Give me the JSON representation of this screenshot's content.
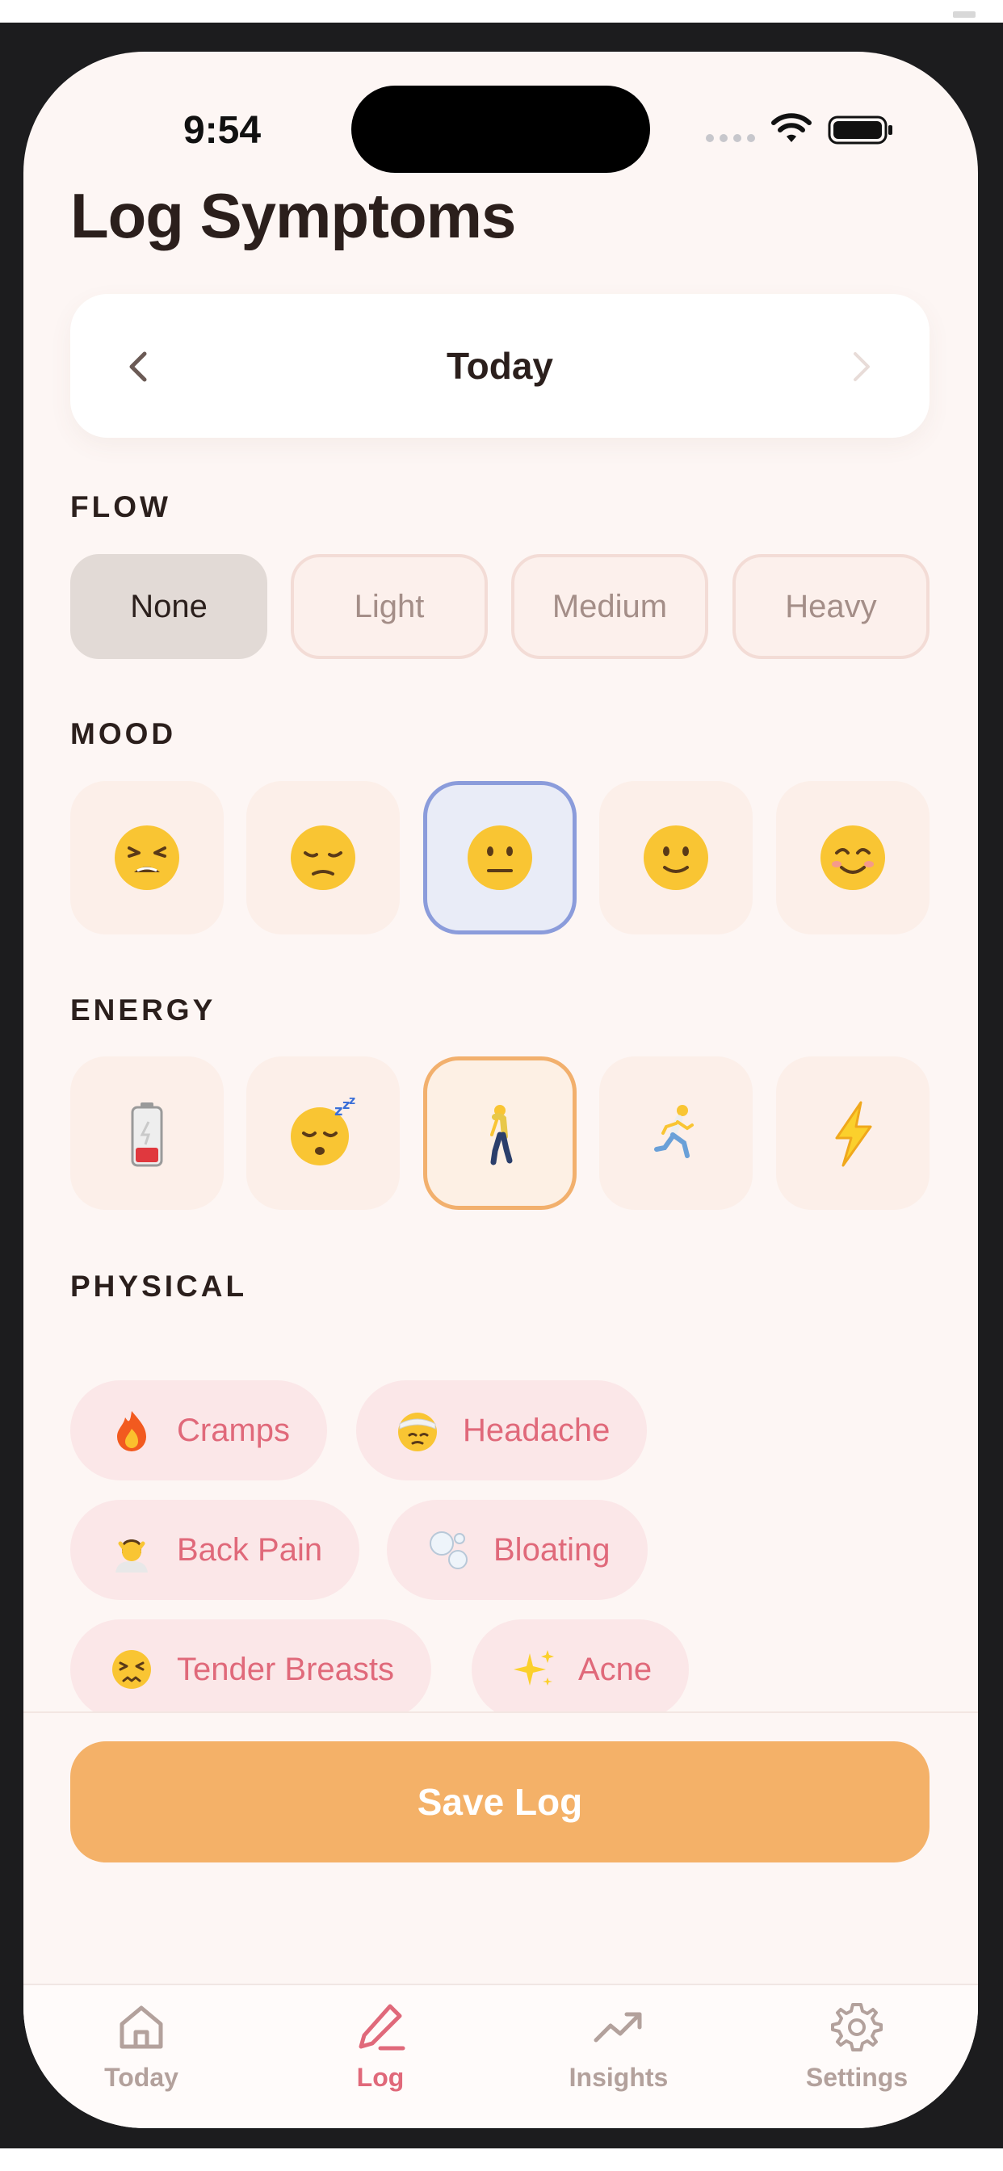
{
  "status_bar": {
    "time": "9:54"
  },
  "header": {
    "title": "Log Symptoms"
  },
  "date_nav": {
    "label": "Today"
  },
  "sections": {
    "flow": "FLOW",
    "mood": "MOOD",
    "energy": "ENERGY",
    "physical": "PHYSICAL"
  },
  "flow": {
    "options": [
      "None",
      "Light",
      "Medium",
      "Heavy"
    ],
    "selected": "None"
  },
  "mood": {
    "options": [
      "tired-face-icon",
      "pensive-face-icon",
      "neutral-face-icon",
      "slightly-smiling-face-icon",
      "smiling-face-icon"
    ],
    "selected_index": 2
  },
  "energy": {
    "options": [
      "low-battery-icon",
      "sleeping-face-icon",
      "walking-person-icon",
      "running-person-icon",
      "lightning-icon"
    ],
    "selected_index": 2
  },
  "physical": {
    "chips": [
      {
        "label": "Cramps",
        "icon": "fire-icon"
      },
      {
        "label": "Headache",
        "icon": "bandaged-head-icon"
      },
      {
        "label": "Back Pain",
        "icon": "massage-icon"
      },
      {
        "label": "Bloating",
        "icon": "bubbles-icon"
      },
      {
        "label": "Tender Breasts",
        "icon": "persevering-face-icon"
      },
      {
        "label": "Acne",
        "icon": "sparkles-icon"
      }
    ]
  },
  "actions": {
    "save_label": "Save Log"
  },
  "tabbar": {
    "tabs": [
      {
        "label": "Today",
        "icon": "home-icon"
      },
      {
        "label": "Log",
        "icon": "pencil-icon"
      },
      {
        "label": "Insights",
        "icon": "trend-up-icon"
      },
      {
        "label": "Settings",
        "icon": "gear-icon"
      }
    ],
    "active": "Log"
  },
  "colors": {
    "background": "#fdf6f4",
    "accent_pink": "#e0697a",
    "accent_orange": "#f4b168",
    "mood_selected": "#8b9cdb",
    "energy_selected": "#f2b06d",
    "title_text": "#2b1f1c"
  }
}
